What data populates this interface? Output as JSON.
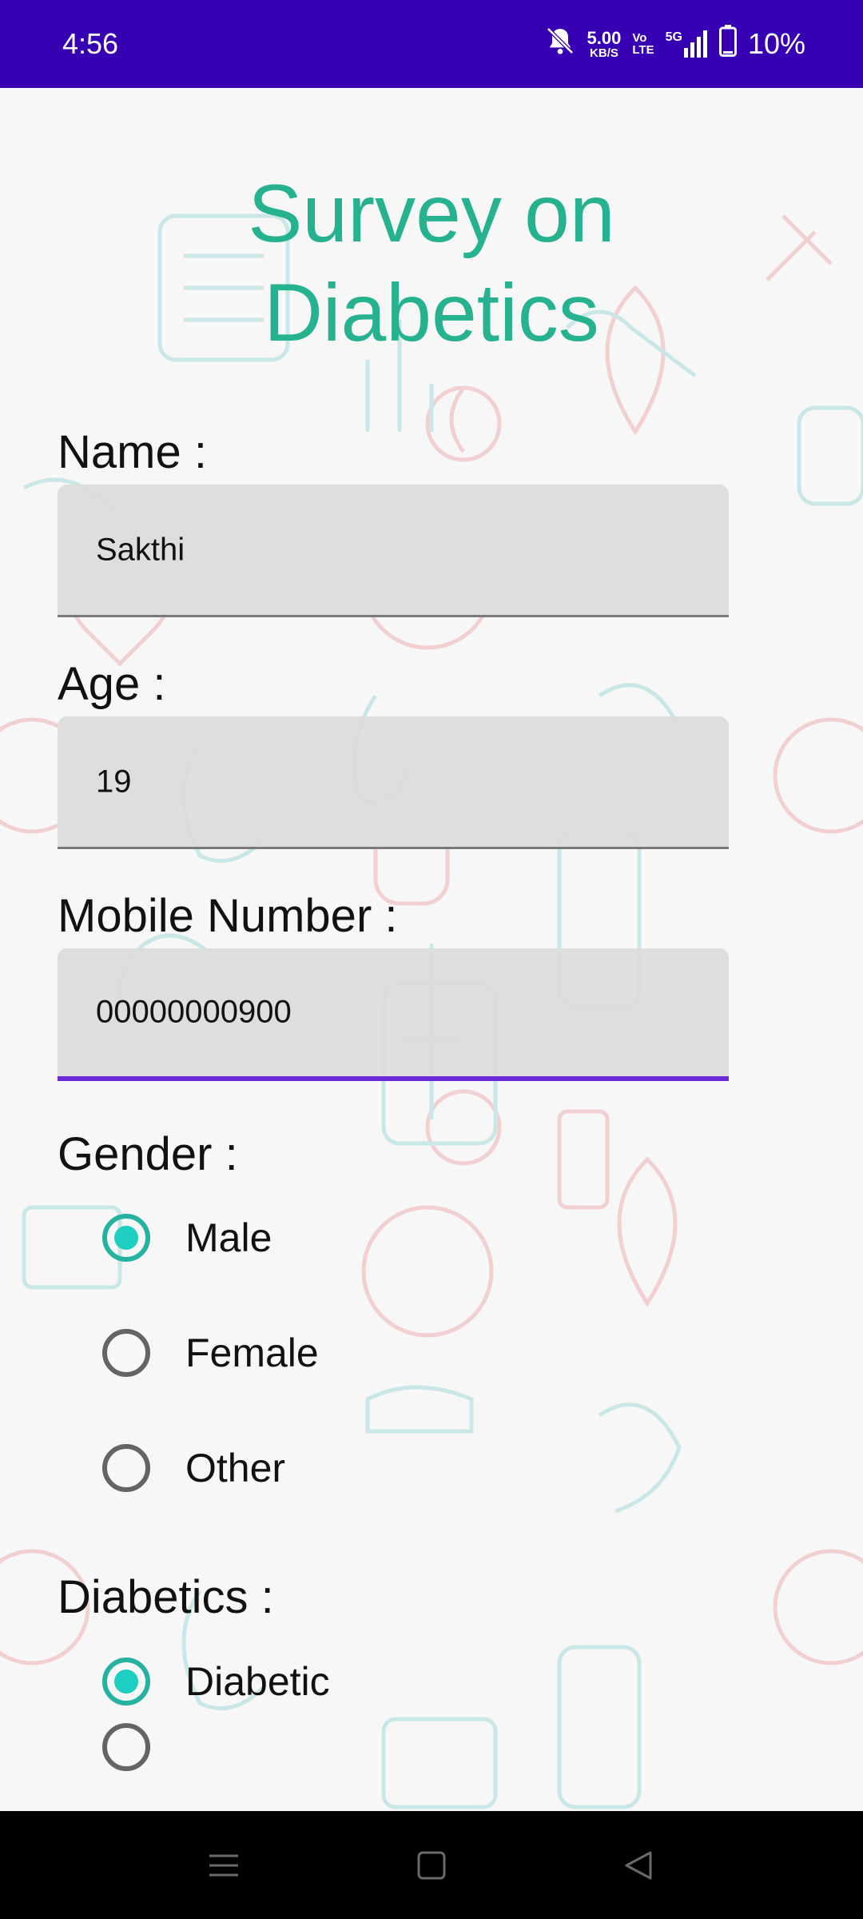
{
  "status_bar": {
    "time": "4:56",
    "speed_value": "5.00",
    "speed_unit": "KB/S",
    "volte_top": "Vo",
    "volte_bottom": "LTE",
    "network": "5G",
    "battery": "10%",
    "icons": [
      "bell-muted-icon",
      "signal-icon",
      "battery-icon"
    ]
  },
  "title": "Survey on\nDiabetics",
  "form": {
    "name_label": "Name :",
    "name_value": "Sakthi",
    "age_label": "Age :",
    "age_value": "19",
    "mobile_label": "Mobile Number :",
    "mobile_value": "00000000900",
    "gender_label": "Gender :",
    "gender_options": [
      {
        "label": "Male",
        "checked": true
      },
      {
        "label": "Female",
        "checked": false
      },
      {
        "label": "Other",
        "checked": false
      }
    ],
    "diabetics_label": "Diabetics :",
    "diabetics_options": [
      {
        "label": "Diabetic",
        "checked": true
      },
      {
        "label": "",
        "checked": false
      }
    ]
  },
  "nav": {
    "icons": [
      "menu-icon",
      "home-square-icon",
      "back-triangle-icon"
    ]
  },
  "colors": {
    "status_bar": "#3700b3",
    "title": "#26b28f",
    "focus_underline": "#6a2bd6",
    "radio_checked": "#1ccfc0"
  }
}
